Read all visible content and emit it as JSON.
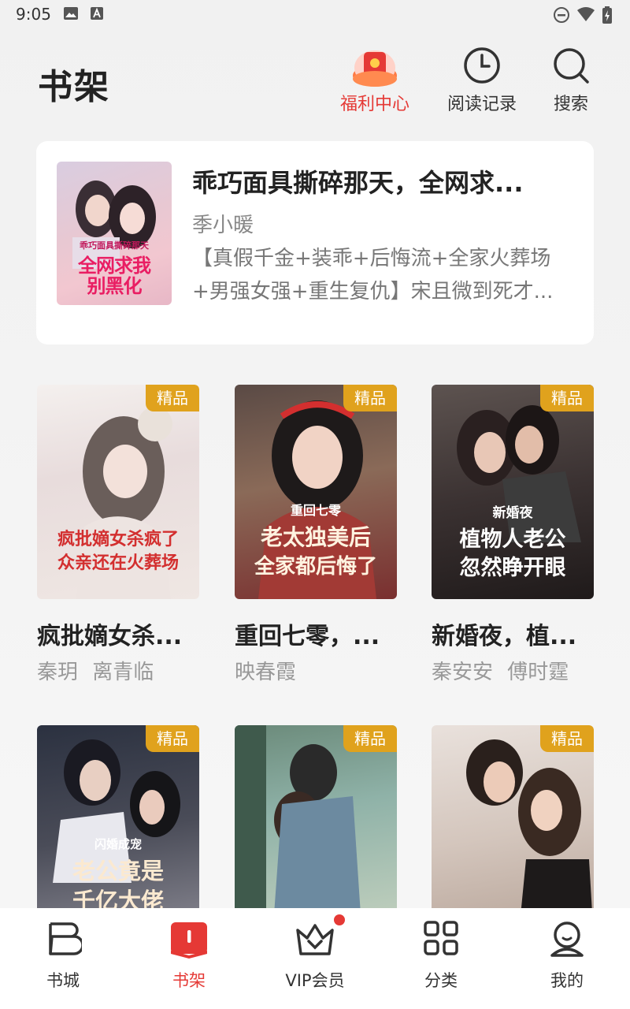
{
  "status_bar": {
    "time": "9:05"
  },
  "header": {
    "title": "书架",
    "actions": [
      {
        "label": "福利中心",
        "icon": "red-envelope-icon",
        "color": "#e53935"
      },
      {
        "label": "阅读记录",
        "icon": "clock-icon"
      },
      {
        "label": "搜索",
        "icon": "search-icon"
      }
    ]
  },
  "recent": {
    "title": "乖巧面具撕碎那天，全网求...",
    "author": "季小暖",
    "description": "【真假千金+装乖+后悔流+全家火葬场+男强女强+重生复仇】宋且微到死才...",
    "cover_text": [
      "乖巧面具撕碎那天",
      "全网求我",
      "别黑化"
    ]
  },
  "books": [
    {
      "title": "疯批嫡女杀...",
      "authors": [
        "秦玥",
        "离青临"
      ],
      "badge": "精品",
      "cover_text": [
        "疯批嫡女杀疯了",
        "众亲还在火葬场"
      ]
    },
    {
      "title": "重回七零，...",
      "authors": [
        "映春霞"
      ],
      "badge": "精品",
      "cover_text": [
        "重回七零",
        "老太独美后",
        "全家都后悔了"
      ]
    },
    {
      "title": "新婚夜，植...",
      "authors": [
        "秦安安",
        "傅时霆"
      ],
      "badge": "精品",
      "cover_text": [
        "新婚夜",
        "植物人老公",
        "忽然睁开眼"
      ]
    },
    {
      "title": "",
      "authors": [],
      "badge": "精品",
      "cover_text": [
        "闪婚成宠",
        "老公竟是",
        "千亿大佬"
      ]
    },
    {
      "title": "",
      "authors": [],
      "badge": "精品",
      "cover_text": []
    },
    {
      "title": "",
      "authors": [],
      "badge": "精品",
      "cover_text": []
    }
  ],
  "bottom_nav": [
    {
      "label": "书城",
      "icon": "bookstore-icon"
    },
    {
      "label": "书架",
      "icon": "bookshelf-icon",
      "active": true
    },
    {
      "label": "VIP会员",
      "icon": "crown-icon",
      "notification_dot": true
    },
    {
      "label": "分类",
      "icon": "category-grid-icon"
    },
    {
      "label": "我的",
      "icon": "user-icon"
    }
  ],
  "colors": {
    "accent": "#e53935",
    "badge": "#e0a21d",
    "text": "#222222",
    "muted": "#999999"
  }
}
